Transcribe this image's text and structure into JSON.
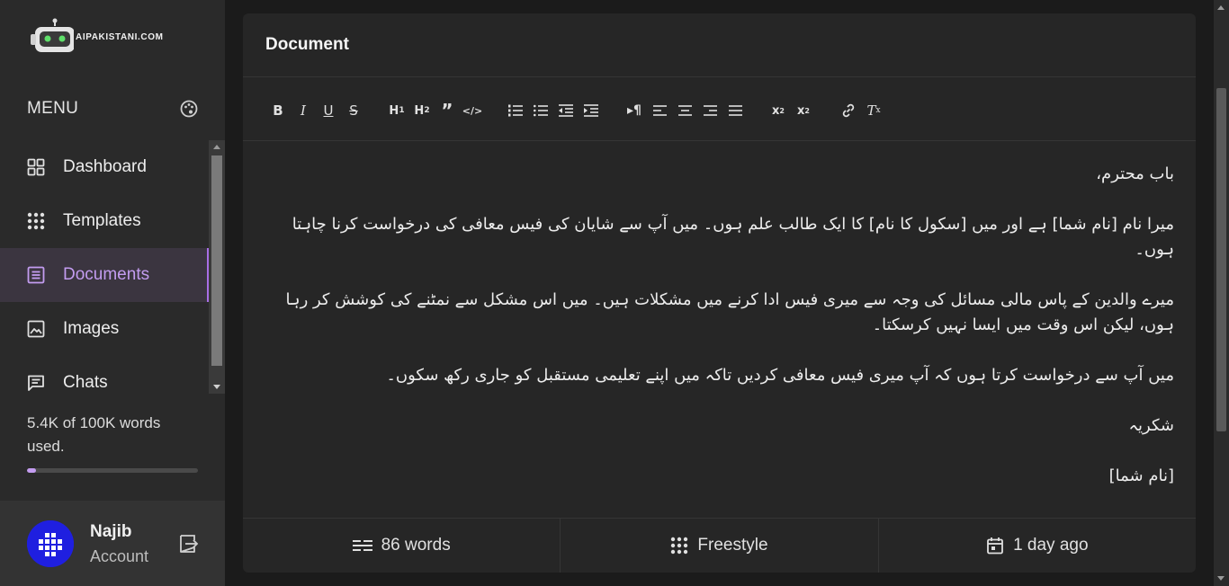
{
  "brand": {
    "name": "AIPAKISTANI.COM"
  },
  "sidebar": {
    "menu_title": "MENU",
    "items": [
      {
        "label": "Dashboard",
        "icon": "grid-icon"
      },
      {
        "label": "Templates",
        "icon": "dots-grid-icon"
      },
      {
        "label": "Documents",
        "icon": "document-icon",
        "active": true
      },
      {
        "label": "Images",
        "icon": "image-icon"
      },
      {
        "label": "Chats",
        "icon": "chat-icon"
      }
    ],
    "usage_text": "5.4K of 100K words used.",
    "usage_fraction": 0.054
  },
  "user": {
    "name": "Najib",
    "subtitle": "Account"
  },
  "document": {
    "title": "Document",
    "paragraphs": [
      "باب محترم،",
      "میرا نام [نام شما] ہے اور میں [سکول کا نام] کا ایک طالب علم ہوں۔ میں آپ سے شایان کی فیس معافی کی درخواست کرنا چاہتا ہوں۔",
      "میرے والدین کے پاس مالی مسائل کی وجہ سے میری فیس ادا کرنے میں مشکلات ہیں۔ میں اس مشکل سے نمٹنے کی کوشش کر رہا ہوں، لیکن اس وقت میں ایسا نہیں کرسکتا۔",
      "میں آپ سے درخواست کرتا ہوں کہ آپ میری فیس معافی کردیں تاکہ میں اپنے تعلیمی مستقبل کو جاری رکھ سکوں۔",
      "شکریہ",
      "[نام شما]"
    ]
  },
  "footer": {
    "words": "86 words",
    "template": "Freestyle",
    "updated": "1 day ago"
  },
  "colors": {
    "accent": "#c39cf0",
    "sidebar_bg": "#2a2a2a",
    "card_bg": "#262626"
  }
}
